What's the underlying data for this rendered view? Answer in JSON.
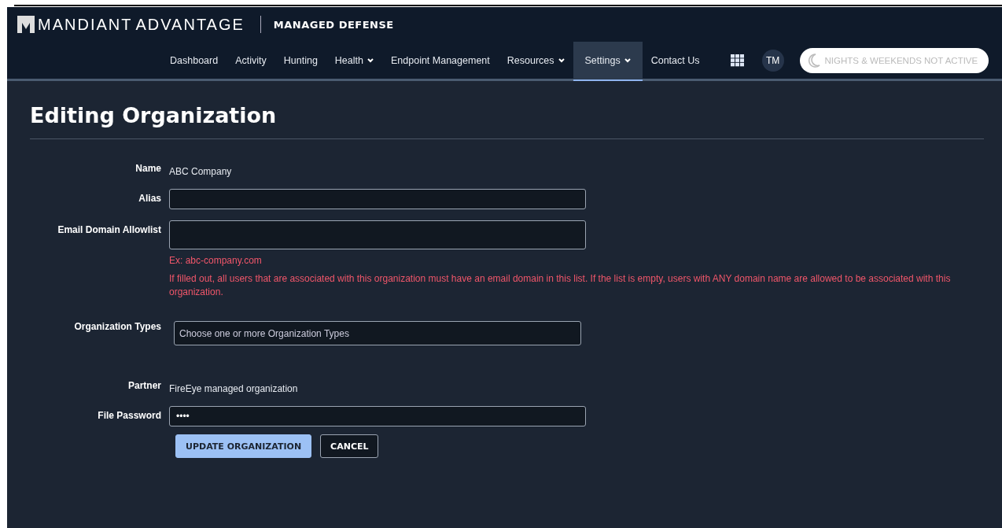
{
  "header": {
    "brand": "MANDIANT",
    "brand_2": "ADVANTAGE",
    "product": "MANAGED DEFENSE"
  },
  "nav": [
    {
      "label": "Dashboard",
      "dropdown": false,
      "selected": false
    },
    {
      "label": "Activity",
      "dropdown": false,
      "selected": false
    },
    {
      "label": "Hunting",
      "dropdown": false,
      "selected": false
    },
    {
      "label": "Health",
      "dropdown": true,
      "selected": false
    },
    {
      "label": "Endpoint Management",
      "dropdown": false,
      "selected": false
    },
    {
      "label": "Resources",
      "dropdown": true,
      "selected": false
    },
    {
      "label": "Settings",
      "dropdown": true,
      "selected": true
    },
    {
      "label": "Contact Us",
      "dropdown": false,
      "selected": false
    }
  ],
  "user": {
    "initials": "TM"
  },
  "nights_weekends": {
    "label": "NIGHTS & WEEKENDS NOT ACTIVE"
  },
  "page": {
    "title": "Editing Organization"
  },
  "form": [
    {
      "kind": "text",
      "label": "Name",
      "value": "ABC Company"
    },
    {
      "kind": "input",
      "label": "Alias"
    },
    {
      "kind": "input-tall",
      "label": "Email Domain Allowlist",
      "help": [
        "Ex: abc-company.com",
        "If filled out, all users that are associated with this organization must have an email domain in this list. If the list is empty, users with ANY domain name are allowed to be associated with this organization."
      ]
    },
    {
      "kind": "select",
      "label": "Organization Types",
      "placeholder": "Choose one or more Organization Types"
    },
    {
      "kind": "text",
      "label": "Partner",
      "value": "FireEye managed organization"
    },
    {
      "kind": "password",
      "label": "File Password",
      "value": "••••"
    }
  ],
  "buttons": [
    {
      "label": "UPDATE ORGANIZATION",
      "primary": true
    },
    {
      "label": "CANCEL",
      "primary": false
    }
  ]
}
